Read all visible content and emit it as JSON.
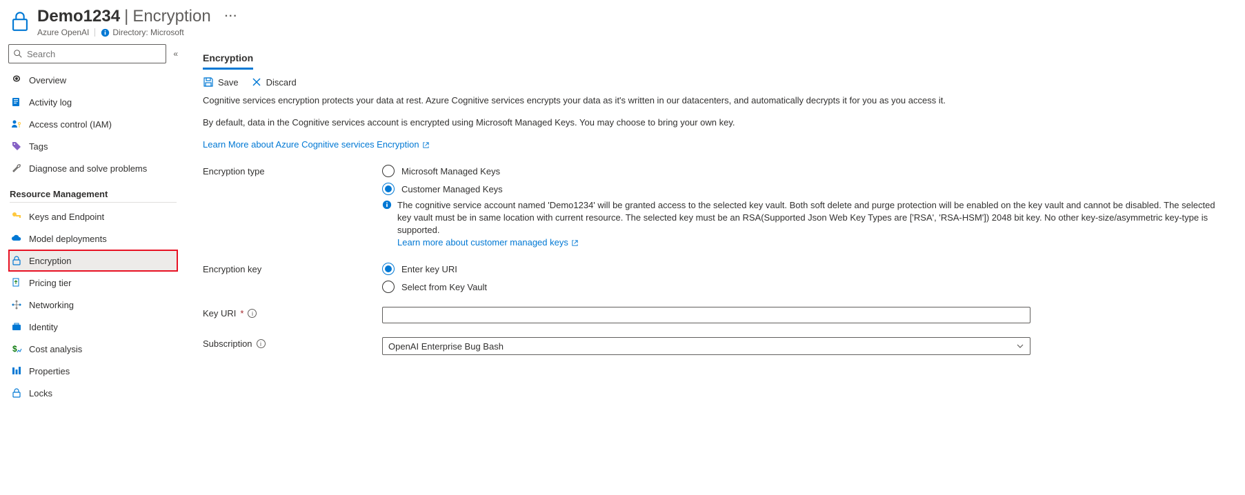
{
  "header": {
    "resource_name": "Demo1234",
    "page_name": "Encryption",
    "resource_type": "Azure OpenAI",
    "directory_label": "Directory: Microsoft",
    "more": "···"
  },
  "sidebar": {
    "search_placeholder": "Search",
    "items": [
      {
        "id": "overview",
        "label": "Overview",
        "icon": "spiral"
      },
      {
        "id": "activity-log",
        "label": "Activity log",
        "icon": "log"
      },
      {
        "id": "access-control",
        "label": "Access control (IAM)",
        "icon": "person-key"
      },
      {
        "id": "tags",
        "label": "Tags",
        "icon": "tag"
      },
      {
        "id": "diagnose",
        "label": "Diagnose and solve problems",
        "icon": "wrench"
      }
    ],
    "section_label": "Resource Management",
    "rm_items": [
      {
        "id": "keys-endpoint",
        "label": "Keys and Endpoint",
        "icon": "key"
      },
      {
        "id": "model-deployments",
        "label": "Model deployments",
        "icon": "cloud"
      },
      {
        "id": "encryption",
        "label": "Encryption",
        "icon": "lock",
        "active": true,
        "highlighted": true
      },
      {
        "id": "pricing-tier",
        "label": "Pricing tier",
        "icon": "doc-up"
      },
      {
        "id": "networking",
        "label": "Networking",
        "icon": "network"
      },
      {
        "id": "identity",
        "label": "Identity",
        "icon": "briefcase"
      },
      {
        "id": "cost-analysis",
        "label": "Cost analysis",
        "icon": "dollar"
      },
      {
        "id": "properties",
        "label": "Properties",
        "icon": "bars"
      },
      {
        "id": "locks",
        "label": "Locks",
        "icon": "lock-outline"
      }
    ]
  },
  "main": {
    "tab_label": "Encryption",
    "save_label": "Save",
    "discard_label": "Discard",
    "desc1": "Cognitive services encryption protects your data at rest. Azure Cognitive services encrypts your data as it's written in our datacenters, and automatically decrypts it for you as you access it.",
    "desc2": "By default, data in the Cognitive services account is encrypted using Microsoft Managed Keys. You may choose to bring your own key.",
    "learn_more_enc": "Learn More about Azure Cognitive services Encryption",
    "enc_type_label": "Encryption type",
    "enc_type_opt1": "Microsoft Managed Keys",
    "enc_type_opt2": "Customer Managed Keys",
    "cmk_info": "The cognitive service account named 'Demo1234' will be granted access to the selected key vault. Both soft delete and purge protection will be enabled on the key vault and cannot be disabled. The selected key vault must be in same location with current resource. The selected key must be an RSA(Supported Json Web Key Types are ['RSA', 'RSA-HSM']) 2048 bit key. No other key-size/asymmetric key-type is supported.",
    "cmk_learn_more": "Learn more about customer managed keys",
    "enc_key_label": "Encryption key",
    "enc_key_opt1": "Enter key URI",
    "enc_key_opt2": "Select from Key Vault",
    "key_uri_label": "Key URI",
    "subscription_label": "Subscription",
    "subscription_value": "OpenAI Enterprise Bug Bash"
  }
}
